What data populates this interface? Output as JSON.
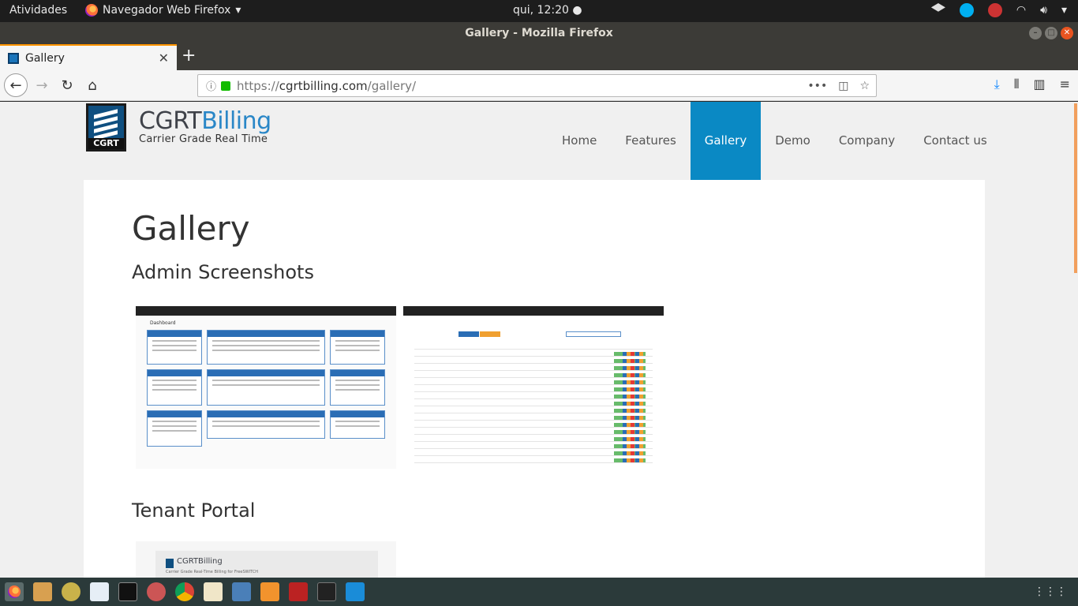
{
  "topbar": {
    "activities": "Atividades",
    "app_menu": "Navegador Web Firefox",
    "clock": "qui, 12:20"
  },
  "window": {
    "title": "Gallery - Mozilla Firefox"
  },
  "tab": {
    "title": "Gallery"
  },
  "urlbar": {
    "scheme": "https://",
    "host": "cgrtbilling.com",
    "path": "/gallery/"
  },
  "site": {
    "logo_mark_text": "CGRT",
    "logo_name_a": "CGRT",
    "logo_name_b": "Billing",
    "logo_tagline": "Carrier Grade Real Time",
    "menu": [
      "Home",
      "Features",
      "Gallery",
      "Demo",
      "Company",
      "Contact us"
    ],
    "active_menu": "Gallery"
  },
  "page": {
    "title": "Gallery",
    "section_admin": "Admin Screenshots",
    "section_tenant": "Tenant Portal",
    "admin_thumb_1_heading": "Dashboard",
    "tenant_thumb_logo": "CGRTBilling",
    "tenant_thumb_sub": "Carrier Grade Real-Time Billing for FreeSWITCH"
  },
  "colors": {
    "accent": "#0a89c4",
    "brand_blue": "#2a87c7"
  }
}
